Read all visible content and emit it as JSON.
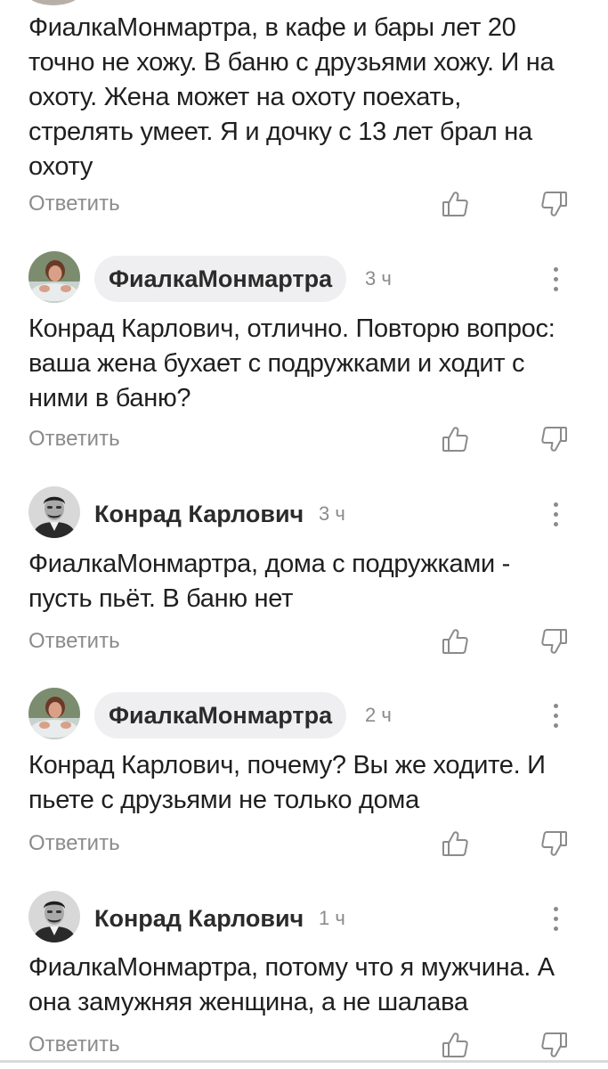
{
  "thread": {
    "reply_label": "Ответить",
    "first_comment": {
      "text": "ФиалкаМонмартра, в кафе и бары лет 20\nточно не хожу. В баню с друзьями хожу. И на\nохоту. Жена может на охоту поехать,\nстрелять умеет. Я и дочку с 13 лет брал на\nохоту"
    },
    "comments": [
      {
        "author": "ФиалкаМонмартра",
        "time": "3 ч",
        "text": "Конрад Карлович, отлично. Повторю вопрос:\nваша жена бухает с подружками и ходит с\nними в баню?"
      },
      {
        "author": "Конрад Карлович",
        "time": "3 ч",
        "text": "ФиалкаМонмартра, дома с подружками -\nпусть пьёт. В баню нет"
      },
      {
        "author": "ФиалкаМонмартра",
        "time": "2 ч",
        "text": "Конрад Карлович, почему? Вы же ходите. И\nпьете с друзьями не только дома"
      },
      {
        "author": "Конрад Карлович",
        "time": "1 ч",
        "text": "ФиалкаМонмартра, потому что я мужчина. А\nона замужняя женщина, а не шалава"
      }
    ]
  },
  "colors": {
    "text": "#1f1f1f",
    "muted": "#8b8b8b",
    "pill_background": "#efeff1"
  },
  "icons": {
    "like": "thumbs-up-icon",
    "dislike": "thumbs-down-icon",
    "more": "more-vertical-icon"
  }
}
